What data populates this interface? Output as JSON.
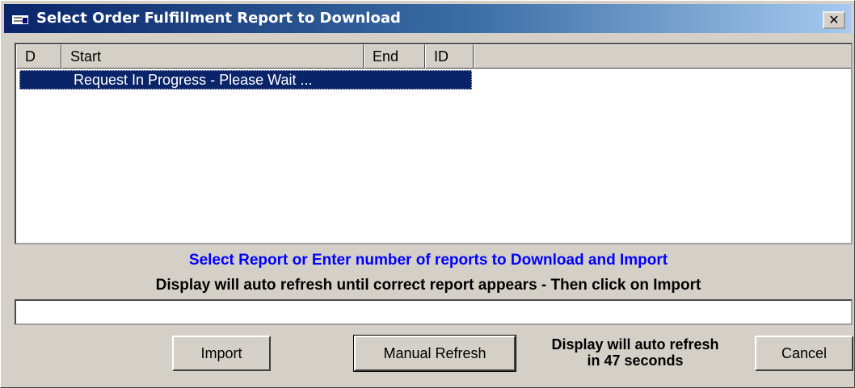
{
  "window": {
    "title": "Select Order Fulfillment Report to Download",
    "close_label": "✕"
  },
  "list": {
    "columns": [
      "D",
      "Start",
      "End",
      "ID"
    ],
    "rows": [
      {
        "text": "Request In Progress - Please Wait ...",
        "selected": true
      }
    ]
  },
  "instructions": {
    "primary": "Select Report or Enter number of reports to Download and Import",
    "secondary": "Display will auto refresh until correct report appears - Then click on Import"
  },
  "report_count_input": {
    "value": "",
    "placeholder": ""
  },
  "buttons": {
    "import": "Import",
    "manual_refresh": "Manual Refresh",
    "cancel": "Cancel"
  },
  "refresh_status": {
    "line1": "Display will auto refresh",
    "line2": "in 47 seconds",
    "seconds_remaining": 47
  },
  "colors": {
    "titlebar_start": "#0a246a",
    "titlebar_end": "#a6caf0",
    "selection": "#0a246a",
    "instruction_primary": "#0000ff",
    "window_face": "#d4d0c8"
  },
  "icons": {
    "app": "window-app-icon",
    "close": "close-icon"
  }
}
